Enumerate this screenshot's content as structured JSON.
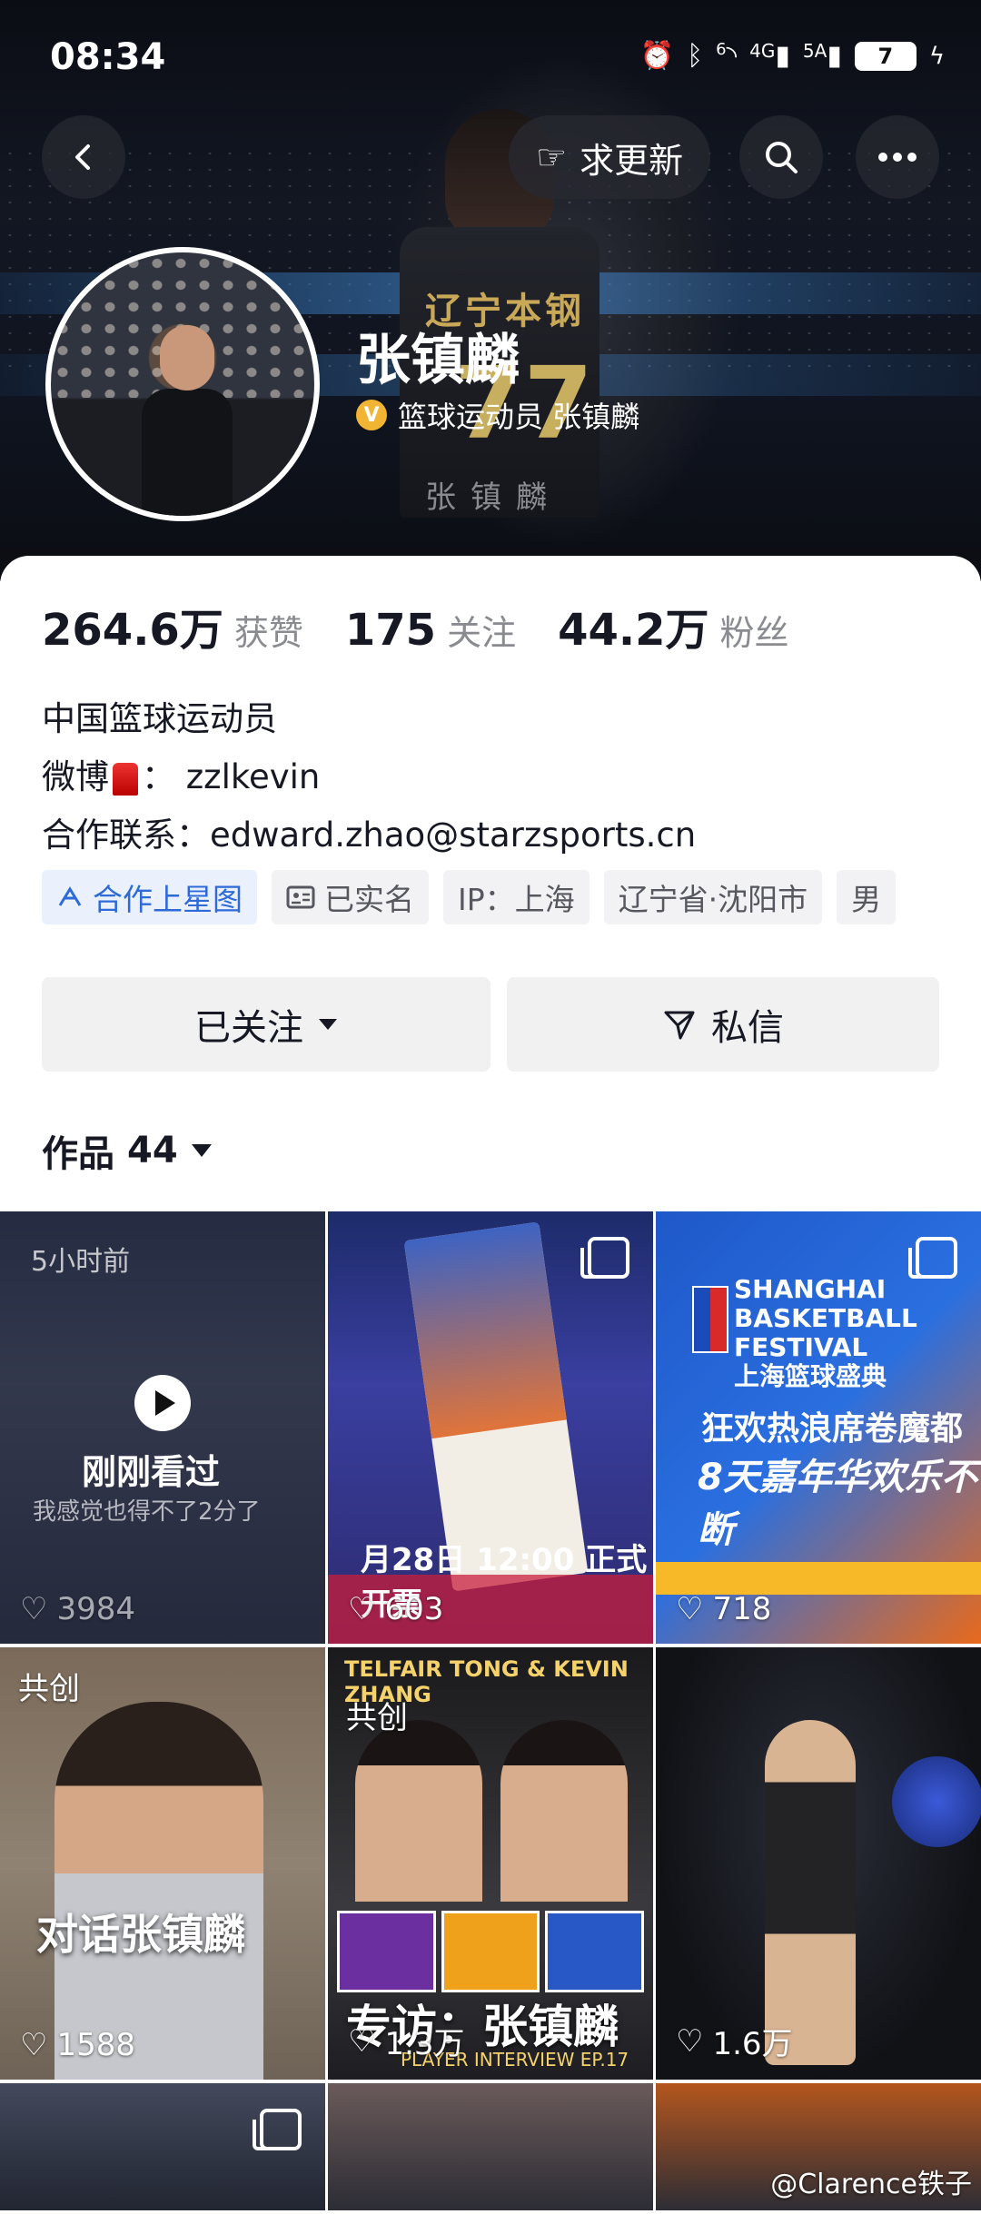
{
  "status_bar": {
    "time": "08:34",
    "network_1": "4G",
    "network_2": "5A",
    "battery": "7",
    "wifi_badge": "6"
  },
  "nav": {
    "request_update_label": "求更新"
  },
  "profile": {
    "name": "张镇麟",
    "verification": "篮球运动员 张镇麟",
    "verify_badge": "V",
    "accent_color": "#f2b533",
    "jersey_team": "辽宁本钢",
    "jersey_number": "77",
    "jersey_name": "张镇麟"
  },
  "stats": [
    {
      "value": "264.6万",
      "label": "获赞"
    },
    {
      "value": "175",
      "label": "关注"
    },
    {
      "value": "44.2万",
      "label": "粉丝"
    }
  ],
  "bio": {
    "line1": "中国篮球运动员",
    "weibo_prefix": "微博",
    "weibo_sep": "：",
    "weibo_handle": "zzlkevin",
    "contact_prefix": "合作联系：",
    "contact_email": "edward.zhao@starzsports.cn"
  },
  "tags": [
    {
      "label": "合作上星图",
      "icon": "star-map-icon"
    },
    {
      "label": "已实名",
      "icon": "id-card-icon"
    },
    {
      "label": "IP：上海"
    },
    {
      "label": "辽宁省·沈阳市"
    },
    {
      "label": "男"
    }
  ],
  "actions": {
    "follow_label": "已关注",
    "message_label": "私信"
  },
  "works": {
    "label": "作品",
    "count": "44"
  },
  "videos": [
    {
      "likes": "3984",
      "time_ago": "5小时前",
      "overlay": "刚刚看过",
      "caption": "我感觉也得不了2分了"
    },
    {
      "likes": "603",
      "caption": "月28日 12:00 正式开票"
    },
    {
      "likes": "718",
      "caption_title": "SHANGHAI BASKETBALL FESTIVAL",
      "caption_sub": "上海篮球盛典",
      "line1": "狂欢热浪席卷魔都",
      "line2": "8天嘉年华欢乐不断"
    },
    {
      "likes": "1588",
      "co_create": "共创",
      "caption": "对话张镇麟"
    },
    {
      "likes": "1.3万",
      "co_create": "共创",
      "header": "TELFAIR TONG & KEVIN ZHANG",
      "caption": "专访：张镇麟",
      "episode": "PLAYER INTERVIEW EP.17"
    },
    {
      "likes": "1.6万"
    },
    {},
    {},
    {}
  ],
  "watermark": "@Clarence铁子"
}
